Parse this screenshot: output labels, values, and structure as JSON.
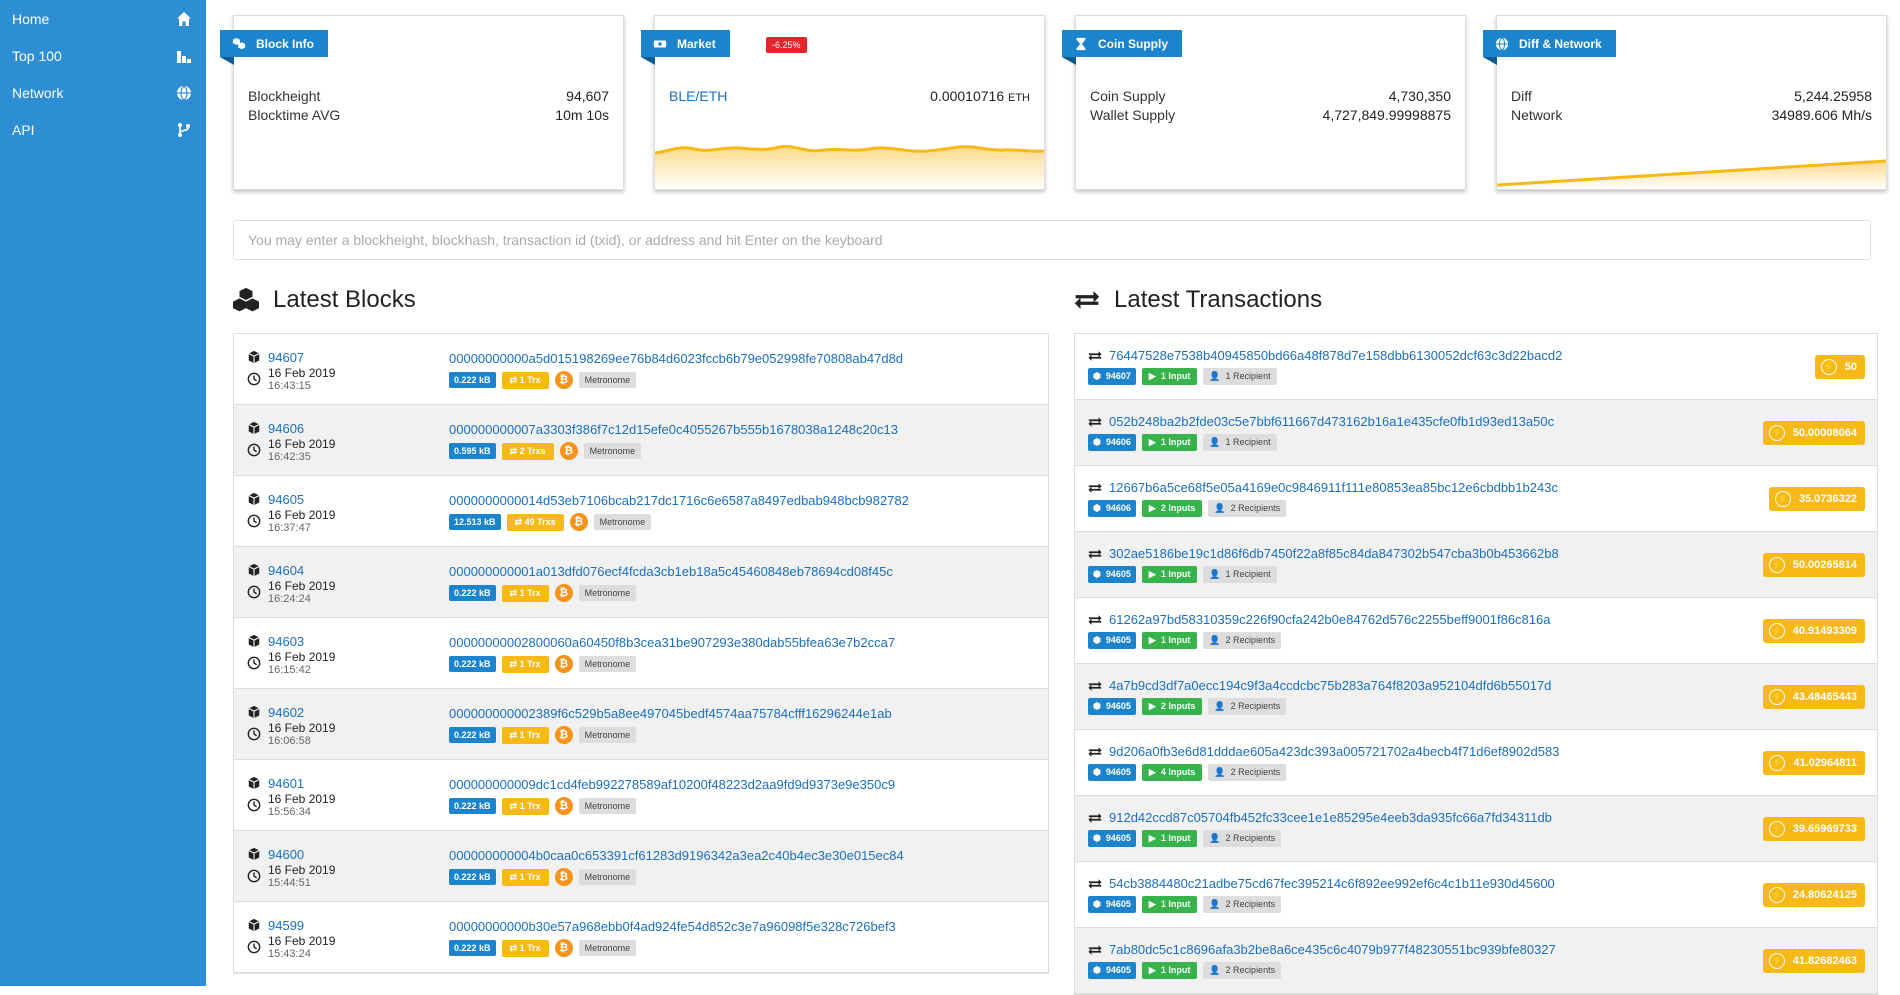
{
  "nav": [
    {
      "label": "Home",
      "icon": "home-icon"
    },
    {
      "label": "Top 100",
      "icon": "ranking-icon"
    },
    {
      "label": "Network",
      "icon": "globe-icon"
    },
    {
      "label": "API",
      "icon": "code-branch-icon"
    }
  ],
  "cards": {
    "block_info": {
      "title": "Block Info",
      "rows": [
        {
          "k": "Blockheight",
          "v": "94,607"
        },
        {
          "k": "Blocktime AVG",
          "v": "10m 10s"
        }
      ]
    },
    "market": {
      "title": "Market",
      "change": "-6.25%",
      "pair": "BLE/ETH",
      "price": "0.00010716",
      "unit": "ETH"
    },
    "coin_supply": {
      "title": "Coin Supply",
      "rows": [
        {
          "k": "Coin Supply",
          "v": "4,730,350"
        },
        {
          "k": "Wallet Supply",
          "v": "4,727,849.99998875"
        }
      ]
    },
    "diff_network": {
      "title": "Diff & Network",
      "rows": [
        {
          "k": "Diff",
          "v": "5,244.25958"
        },
        {
          "k": "Network",
          "v": "34989.606 Mh/s"
        }
      ]
    }
  },
  "colors": {
    "accent": "#2e8ed4",
    "badge_blue": "#1b84cd",
    "badge_yellow": "#f6b917",
    "badge_green": "#36b34a",
    "badge_red": "#e1262c",
    "link": "#1a6fc0"
  },
  "search": {
    "placeholder": "You may enter a blockheight, blockhash, transaction id (txid), or address and hit Enter on the keyboard"
  },
  "latest_blocks": {
    "title": "Latest Blocks",
    "rows": [
      {
        "height": "94607",
        "date": "16 Feb 2019",
        "time": "16:43:15",
        "hash": "00000000000a5d015198269ee76b84d6023fccb6b79e052998fe70808ab47d8d",
        "size": "0.222 kB",
        "txs": "1 Trx",
        "miner": "Metronome"
      },
      {
        "height": "94606",
        "date": "16 Feb 2019",
        "time": "16:42:35",
        "hash": "000000000007a3303f386f7c12d15efe0c4055267b555b1678038a1248c20c13",
        "size": "0.595 kB",
        "txs": "2 Trxs",
        "miner": "Metronome"
      },
      {
        "height": "94605",
        "date": "16 Feb 2019",
        "time": "16:37:47",
        "hash": "0000000000014d53eb7106bcab217dc1716c6e6587a8497edbab948bcb982782",
        "size": "12.513 kB",
        "txs": "49 Trxs",
        "miner": "Metronome"
      },
      {
        "height": "94604",
        "date": "16 Feb 2019",
        "time": "16:24:24",
        "hash": "000000000001a013dfd076ecf4fcda3cb1eb18a5c45460848eb78694cd08f45c",
        "size": "0.222 kB",
        "txs": "1 Trx",
        "miner": "Metronome"
      },
      {
        "height": "94603",
        "date": "16 Feb 2019",
        "time": "16:15:42",
        "hash": "00000000002800060a60450f8b3cea31be907293e380dab55bfea63e7b2cca7",
        "size": "0.222 kB",
        "txs": "1 Trx",
        "miner": "Metronome"
      },
      {
        "height": "94602",
        "date": "16 Feb 2019",
        "time": "16:06:58",
        "hash": "000000000002389f6c529b5a8ee497045bedf4574aa75784cfff16296244e1ab",
        "size": "0.222 kB",
        "txs": "1 Trx",
        "miner": "Metronome"
      },
      {
        "height": "94601",
        "date": "16 Feb 2019",
        "time": "15:56:34",
        "hash": "000000000009dc1cd4feb992278589af10200f48223d2aa9fd9d9373e9e350c9",
        "size": "0.222 kB",
        "txs": "1 Trx",
        "miner": "Metronome"
      },
      {
        "height": "94600",
        "date": "16 Feb 2019",
        "time": "15:44:51",
        "hash": "000000000004b0caa0c653391cf61283d9196342a3ea2c40b4ec3e30e015ec84",
        "size": "0.222 kB",
        "txs": "1 Trx",
        "miner": "Metronome"
      },
      {
        "height": "94599",
        "date": "16 Feb 2019",
        "time": "15:43:24",
        "hash": "00000000000b30e57a968ebb0f4ad924fe54d852c3e7a96098f5e328c726bef3",
        "size": "0.222 kB",
        "txs": "1 Trx",
        "miner": "Metronome"
      }
    ]
  },
  "latest_transactions": {
    "title": "Latest Transactions",
    "rows": [
      {
        "txid": "76447528e7538b40945850bd66a48f878d7e158dbb6130052dcf63c3d22bacd2",
        "block": "94607",
        "inputs": "1 Input",
        "recipients": "1 Recipient",
        "amount": "50"
      },
      {
        "txid": "052b248ba2b2fde03c5e7bbf611667d473162b16a1e435cfe0fb1d93ed13a50c",
        "block": "94606",
        "inputs": "1 Input",
        "recipients": "1 Recipient",
        "amount": "50.00008064"
      },
      {
        "txid": "12667b6a5ce68f5e05a4169e0c9846911f111e80853ea85bc12e6cbdbb1b243c",
        "block": "94606",
        "inputs": "2 Inputs",
        "recipients": "2 Recipients",
        "amount": "35.0736322"
      },
      {
        "txid": "302ae5186be19c1d86f6db7450f22a8f85c84da847302b547cba3b0b453662b8",
        "block": "94605",
        "inputs": "1 Input",
        "recipients": "1 Recipient",
        "amount": "50.00265814"
      },
      {
        "txid": "61262a97bd58310359c226f90cfa242b0e84762d576c2255beff9001f86c816a",
        "block": "94605",
        "inputs": "1 Input",
        "recipients": "2 Recipients",
        "amount": "40.91493309"
      },
      {
        "txid": "4a7b9cd3df7a0ecc194c9f3a4ccdcbc75b283a764f8203a952104dfd6b55017d",
        "block": "94605",
        "inputs": "2 Inputs",
        "recipients": "2 Recipients",
        "amount": "43.48465443"
      },
      {
        "txid": "9d206a0fb3e6d81dddae605a423dc393a005721702a4becb4f71d6ef8902d583",
        "block": "94605",
        "inputs": "4 Inputs",
        "recipients": "2 Recipients",
        "amount": "41.02964811"
      },
      {
        "txid": "912d42ccd87c05704fb452fc33cee1e1e85295e4eeb3da935fc66a7fd34311db",
        "block": "94605",
        "inputs": "1 Input",
        "recipients": "2 Recipients",
        "amount": "39.65969733"
      },
      {
        "txid": "54cb3884480c21adbe75cd67fec395214c6f892ee992ef6c4c1b11e930d45600",
        "block": "94605",
        "inputs": "1 Input",
        "recipients": "2 Recipients",
        "amount": "24.80624125"
      },
      {
        "txid": "7ab80dc5c1c8696afa3b2be8a6ce435c6c4079b977f48230551bc939bfe80327",
        "block": "94605",
        "inputs": "1 Input",
        "recipients": "2 Recipients",
        "amount": "41.82682463"
      }
    ]
  }
}
